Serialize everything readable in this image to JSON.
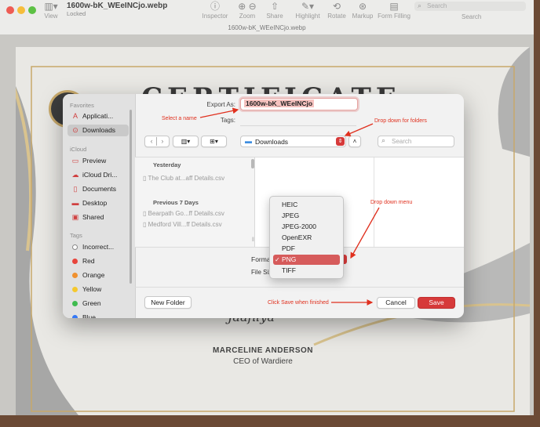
{
  "window": {
    "title": "1600w-bK_WEeINCjo.webp",
    "subtitle": "Locked",
    "doc_label": "1600w-bK_WEeINCjo.webp",
    "toolbar": {
      "view": "View",
      "inspector": "Inspector",
      "zoom": "Zoom",
      "share": "Share",
      "highlight": "Highlight",
      "rotate": "Rotate",
      "markup": "Markup",
      "form_filling": "Form Filling",
      "search_placeholder": "Search",
      "search_label": "Search"
    }
  },
  "certificate": {
    "heading": "CERTIFICATE",
    "signature": "Jaafilya",
    "name": "MARCELINE ANDERSON",
    "role": "CEO of Wardiere"
  },
  "dialog": {
    "export_as_label": "Export As:",
    "export_as_value": "1600w-bK_WEeINCjo",
    "tags_label": "Tags:",
    "location": "Downloads",
    "search_placeholder": "Search",
    "sidebar": {
      "favorites_header": "Favorites",
      "favorites": [
        "Applicati...",
        "Downloads"
      ],
      "icloud_header": "iCloud",
      "icloud": [
        "Preview",
        "iCloud Dri...",
        "Documents",
        "Desktop",
        "Shared"
      ],
      "tags_header": "Tags",
      "tags": [
        {
          "label": "Incorrect...",
          "color": "#ffffff"
        },
        {
          "label": "Red",
          "color": "#e8453c"
        },
        {
          "label": "Orange",
          "color": "#f0912f"
        },
        {
          "label": "Yellow",
          "color": "#f5c82e"
        },
        {
          "label": "Green",
          "color": "#3fbb4f"
        },
        {
          "label": "Blue",
          "color": "#3478f6"
        }
      ]
    },
    "file_list": {
      "group1": "Yesterday",
      "group1_items": [
        "The Club at...aff Details.csv"
      ],
      "group2": "Previous 7 Days",
      "group2_items": [
        "Bearpath Go...ff Details.csv",
        "Medford Vill...ff Details.csv"
      ]
    },
    "format_label": "Format",
    "file_size_label": "File Size",
    "format_options": [
      "HEIC",
      "JPEG",
      "JPEG-2000",
      "OpenEXR",
      "PDF",
      "PNG",
      "TIFF"
    ],
    "format_selected": "PNG",
    "check_mark": "✓",
    "new_folder": "New Folder",
    "cancel": "Cancel",
    "save": "Save"
  },
  "annotations": {
    "select_name": "Select a name",
    "drop_down_folders": "Drop down for folders",
    "drop_down_menu": "Drop down menu",
    "click_save": "Click Save when finished"
  },
  "colors": {
    "accent": "#d63a3a",
    "annotation": "#e0301e",
    "gold": "#c7a86a"
  }
}
